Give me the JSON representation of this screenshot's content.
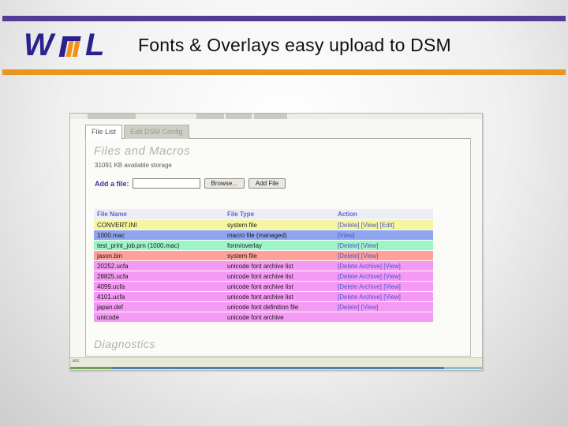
{
  "header": {
    "logo_text": "WML",
    "title": "Fonts & Overlays easy upload to DSM"
  },
  "screenshot": {
    "tabs": [
      {
        "label": "File List",
        "active": true
      },
      {
        "label": "Edit DSM Config",
        "active": false
      }
    ],
    "files_section": {
      "heading": "Files and Macros",
      "storage_text": "31091 KB available storage",
      "add_file_label": "Add a file:",
      "file_input_value": "",
      "browse_button_label": "Browse...",
      "add_file_button_label": "Add File"
    },
    "file_table": {
      "headers": [
        "File Name",
        "File Type",
        "Action"
      ],
      "rows": [
        {
          "name": "CONVERT.INI",
          "type": "system file",
          "actions": "[Delete] [View] [Edit]",
          "color": "#f6f6a2"
        },
        {
          "name": "1000.mac",
          "type": "macro file (managed)",
          "actions": "[View]",
          "color": "#8fa5f0"
        },
        {
          "name": "test_print_job.prn (1000.mac)",
          "type": "form/overlay",
          "actions": "[Delete] [View]",
          "color": "#9df5c8"
        },
        {
          "name": "jason.bin",
          "type": "system file",
          "actions": "[Delete] [View]",
          "color": "#ffa09b"
        },
        {
          "name": "20252.ucfa",
          "type": "unicode font archive list",
          "actions": "[Delete Archive] [View]",
          "color": "#f49af4"
        },
        {
          "name": "28825.ucfa",
          "type": "unicode font archive list",
          "actions": "[Delete Archive] [View]",
          "color": "#f49af4"
        },
        {
          "name": "4099.ucfa",
          "type": "unicode font archive list",
          "actions": "[Delete Archive] [View]",
          "color": "#f49af4"
        },
        {
          "name": "4101.ucfa",
          "type": "unicode font archive list",
          "actions": "[Delete Archive] [View]",
          "color": "#f49af4"
        },
        {
          "name": "japan.def",
          "type": "unicode font definition file",
          "actions": "[Delete] [View]",
          "color": "#f49af4"
        },
        {
          "name": "unicode",
          "type": "unicode font archive",
          "actions": "",
          "color": "#f49af4"
        }
      ]
    },
    "diagnostics_heading": "Diagnostics",
    "status_text": "urc"
  },
  "colors": {
    "purple_bar": "#533b97",
    "orange_bar": "#e8961e",
    "logo_blue": "#29218f",
    "logo_orange": "#f39019",
    "link_blue": "#4a55cc",
    "header_row_bg": "#ededf6",
    "header_text_blue": "#5b66c9"
  }
}
